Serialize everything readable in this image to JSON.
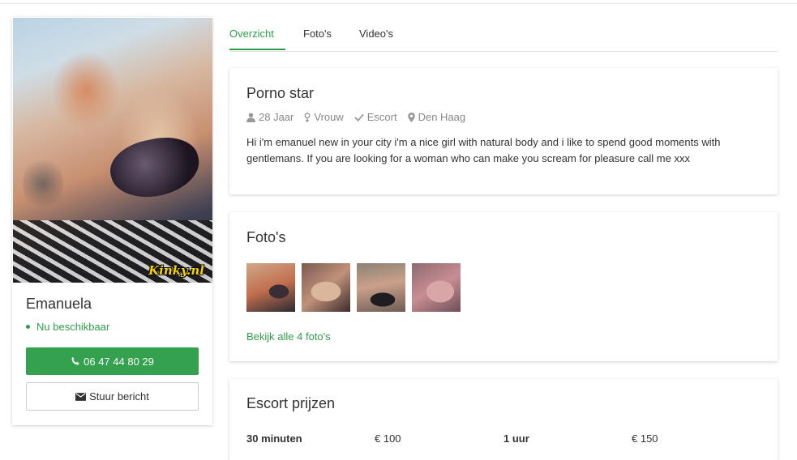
{
  "profile": {
    "watermark": "Kinky.nl",
    "name": "Emanuela",
    "status": "Nu beschikbaar",
    "phone_label": "06 47 44 80 29",
    "message_label": "Stuur bericht"
  },
  "tabs": [
    {
      "label": "Overzicht"
    },
    {
      "label": "Foto's"
    },
    {
      "label": "Video's"
    }
  ],
  "about": {
    "title": "Porno star",
    "meta": {
      "age": "28 Jaar",
      "gender": "Vrouw",
      "type": "Escort",
      "location": "Den Haag"
    },
    "description": "Hi i'm emanuel new in your city i'm a nice girl with natural body and i like to spend good moments with gentlemans. If you are looking for a woman who can make you scream for pleasure call me xxx"
  },
  "photos": {
    "title": "Foto's",
    "see_all": "Bekijk alle 4 foto's"
  },
  "prices": {
    "title": "Escort prijzen",
    "rows": [
      {
        "duration": "30 minuten",
        "price": "€ 100"
      },
      {
        "duration": "1 uur",
        "price": "€ 150"
      }
    ]
  },
  "colors": {
    "accent": "#2e9e4a",
    "button": "#33a14e"
  },
  "icons": [
    "phone-icon",
    "envelope-icon",
    "user-icon",
    "gender-icon",
    "check-icon",
    "map-marker-icon"
  ]
}
